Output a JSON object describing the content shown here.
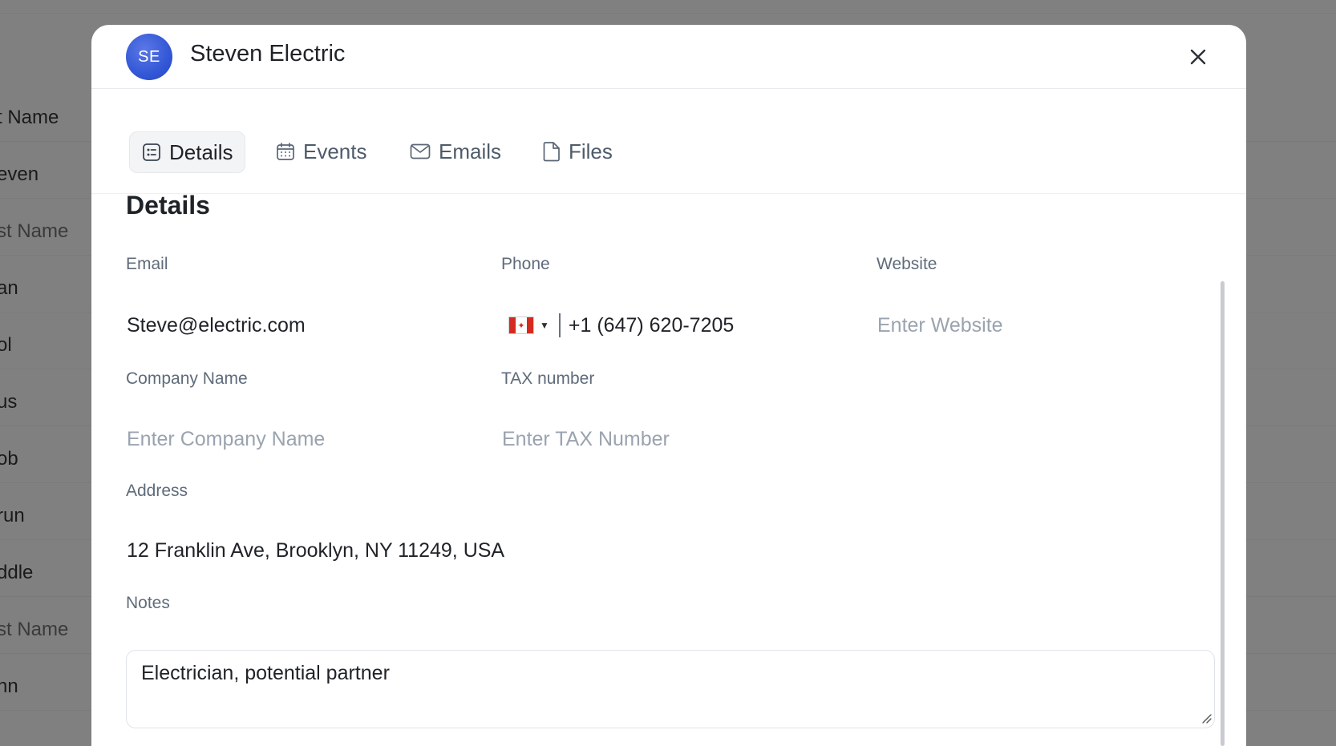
{
  "background": {
    "rows": [
      {
        "text": "t Name",
        "muted": false
      },
      {
        "text": "even",
        "muted": false
      },
      {
        "text": "st Name",
        "muted": true
      },
      {
        "text": "an",
        "muted": false
      },
      {
        "text": "ol",
        "muted": false
      },
      {
        "text": "us",
        "muted": false
      },
      {
        "text": "ob",
        "muted": false
      },
      {
        "text": "run",
        "muted": false
      },
      {
        "text": "ddle",
        "muted": false
      },
      {
        "text": "st Name",
        "muted": true
      },
      {
        "text": "nn",
        "muted": false
      }
    ]
  },
  "modal": {
    "avatar_initials": "SE",
    "title": "Steven Electric",
    "tabs": [
      {
        "label": "Details",
        "icon": "details-icon",
        "active": true
      },
      {
        "label": "Events",
        "icon": "calendar-icon",
        "active": false
      },
      {
        "label": "Emails",
        "icon": "mail-icon",
        "active": false
      },
      {
        "label": "Files",
        "icon": "file-icon",
        "active": false
      }
    ],
    "section_title": "Details",
    "fields": {
      "email": {
        "label": "Email",
        "value": "Steve@electric.com"
      },
      "phone": {
        "label": "Phone",
        "value": "+1 (647) 620-7205",
        "country_flag": "canada-flag-icon"
      },
      "website": {
        "label": "Website",
        "value": "",
        "placeholder": "Enter Website"
      },
      "company": {
        "label": "Company Name",
        "value": "",
        "placeholder": "Enter Company Name"
      },
      "tax": {
        "label": "TAX number",
        "value": "",
        "placeholder": "Enter TAX Number"
      },
      "address": {
        "label": "Address",
        "value": "12 Franklin Ave, Brooklyn, NY 11249, USA"
      },
      "notes": {
        "label": "Notes",
        "value": "Electrician, potential partner"
      }
    }
  },
  "colors": {
    "overlay": "#808080",
    "accent": "#3357d6",
    "label": "#5f6b7a",
    "placeholder": "#9aa3af"
  }
}
